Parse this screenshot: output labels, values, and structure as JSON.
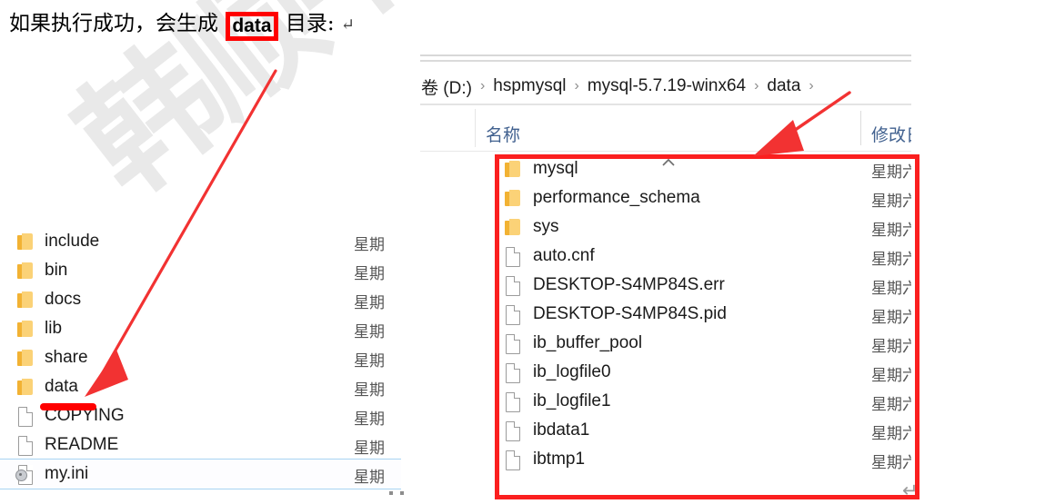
{
  "document": {
    "caption_before": "如果执行成功，会生成",
    "caption_highlight": "data",
    "caption_after": "目录:",
    "pilcrow": "↵",
    "watermark_text": "韩顺平",
    "highlight_color": "#ff0000",
    "annotation_color": "#fb1f1f"
  },
  "left_explorer": {
    "name": "mysql-5.7.19-winx64-folder-listing",
    "date_column_truncated": "星期",
    "items": [
      {
        "name": "include",
        "type": "folder",
        "date": "星期"
      },
      {
        "name": "bin",
        "type": "folder",
        "date": "星期"
      },
      {
        "name": "docs",
        "type": "folder",
        "date": "星期"
      },
      {
        "name": "lib",
        "type": "folder",
        "date": "星期"
      },
      {
        "name": "share",
        "type": "folder",
        "date": "星期"
      },
      {
        "name": "data",
        "type": "folder",
        "date": "星期"
      },
      {
        "name": "COPYING",
        "type": "file",
        "date": "星期"
      },
      {
        "name": "README",
        "type": "file",
        "date": "星期"
      },
      {
        "name": "my.ini",
        "type": "ini",
        "date": "星期",
        "selected": true
      }
    ]
  },
  "right_explorer": {
    "breadcrumb": [
      {
        "label": "卷 (D:)"
      },
      {
        "label": "hspmysql"
      },
      {
        "label": "mysql-5.7.19-winx64"
      },
      {
        "label": "data"
      }
    ],
    "breadcrumb_separator": "›",
    "columns": {
      "name": "名称",
      "modified": "修改日",
      "sort_indicator": "chevron-up-icon"
    },
    "items": [
      {
        "name": "mysql",
        "type": "folder",
        "date": "星期六"
      },
      {
        "name": "performance_schema",
        "type": "folder",
        "date": "星期六"
      },
      {
        "name": "sys",
        "type": "folder",
        "date": "星期六"
      },
      {
        "name": "auto.cnf",
        "type": "file",
        "date": "星期六"
      },
      {
        "name": "DESKTOP-S4MP84S.err",
        "type": "file",
        "date": "星期六"
      },
      {
        "name": "DESKTOP-S4MP84S.pid",
        "type": "file",
        "date": "星期六"
      },
      {
        "name": "ib_buffer_pool",
        "type": "file",
        "date": "星期六"
      },
      {
        "name": "ib_logfile0",
        "type": "file",
        "date": "星期六"
      },
      {
        "name": "ib_logfile1",
        "type": "file",
        "date": "星期六"
      },
      {
        "name": "ibdata1",
        "type": "file",
        "date": "星期六"
      },
      {
        "name": "ibtmp1",
        "type": "file",
        "date": "星期六"
      }
    ],
    "trailing_pilcrow": "↵"
  },
  "annotations": [
    {
      "name": "arrow-to-data-folder",
      "kind": "arrow",
      "color": "#f23232"
    },
    {
      "name": "arrow-to-data-listing",
      "kind": "arrow",
      "color": "#f23232"
    },
    {
      "name": "underline-data-folder",
      "kind": "underline",
      "color": "#ff0000"
    },
    {
      "name": "box-data-contents",
      "kind": "rectangle",
      "color": "#fb1f1f"
    },
    {
      "name": "box-data-word",
      "kind": "rectangle",
      "color": "#ff0000"
    }
  ]
}
